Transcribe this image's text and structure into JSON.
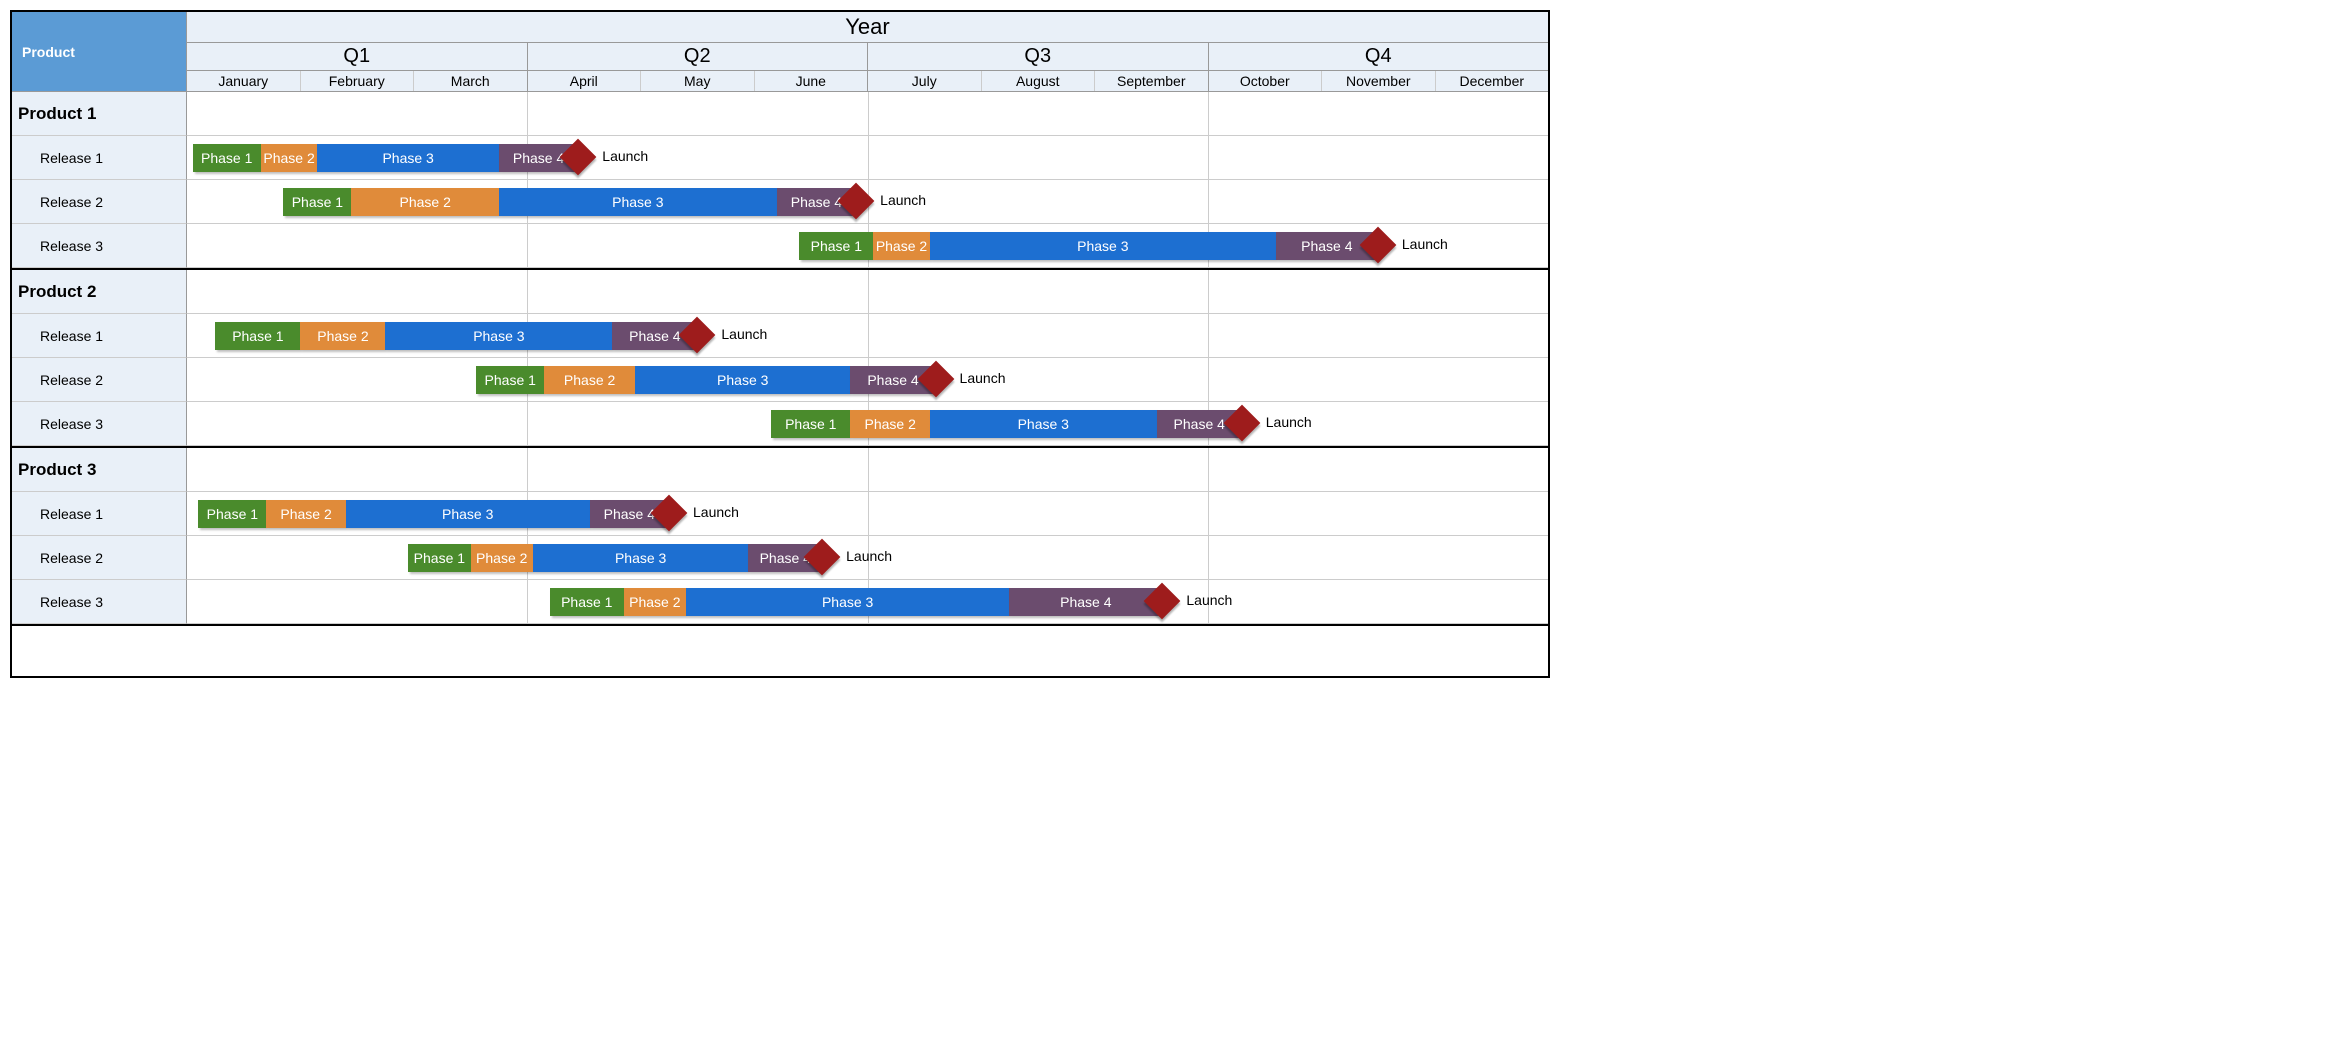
{
  "header": {
    "product_label": "Product",
    "year_label": "Year",
    "quarters": [
      "Q1",
      "Q2",
      "Q3",
      "Q4"
    ],
    "months": [
      "January",
      "February",
      "March",
      "April",
      "May",
      "June",
      "July",
      "August",
      "September",
      "October",
      "November",
      "December"
    ]
  },
  "phase_labels": {
    "phase1": "Phase 1",
    "phase2": "Phase 2",
    "phase3": "Phase 3",
    "phase4": "Phase 4",
    "launch": "Launch"
  },
  "colors": {
    "phase1": "#4a8b2c",
    "phase2": "#e08b3a",
    "phase3": "#1d6fd1",
    "phase4": "#6b4c6e",
    "milestone": "#9e1c1c",
    "header_blue": "#5b9bd5",
    "light_blue": "#e9f0f8"
  },
  "chart_data": {
    "type": "gantt",
    "title": "Year",
    "x_axis": {
      "quarters": [
        "Q1",
        "Q2",
        "Q3",
        "Q4"
      ],
      "months": [
        "January",
        "February",
        "March",
        "April",
        "May",
        "June",
        "July",
        "August",
        "September",
        "October",
        "November",
        "December"
      ],
      "range": [
        0,
        12
      ]
    },
    "products": [
      {
        "name": "Product 1",
        "releases": [
          {
            "name": "Release 1",
            "bars": [
              {
                "phase": "phase1",
                "start": 0.05,
                "end": 0.65
              },
              {
                "phase": "phase2",
                "start": 0.65,
                "end": 1.15
              },
              {
                "phase": "phase3",
                "start": 1.15,
                "end": 2.75
              },
              {
                "phase": "phase4",
                "start": 2.75,
                "end": 3.45
              }
            ],
            "milestone": 3.45
          },
          {
            "name": "Release 2",
            "bars": [
              {
                "phase": "phase1",
                "start": 0.85,
                "end": 1.45
              },
              {
                "phase": "phase2",
                "start": 1.45,
                "end": 2.75
              },
              {
                "phase": "phase3",
                "start": 2.75,
                "end": 5.2
              },
              {
                "phase": "phase4",
                "start": 5.2,
                "end": 5.9
              }
            ],
            "milestone": 5.9
          },
          {
            "name": "Release 3",
            "bars": [
              {
                "phase": "phase1",
                "start": 5.4,
                "end": 6.05
              },
              {
                "phase": "phase2",
                "start": 6.05,
                "end": 6.55
              },
              {
                "phase": "phase3",
                "start": 6.55,
                "end": 9.6
              },
              {
                "phase": "phase4",
                "start": 9.6,
                "end": 10.5
              }
            ],
            "milestone": 10.5
          }
        ]
      },
      {
        "name": "Product 2",
        "releases": [
          {
            "name": "Release 1",
            "bars": [
              {
                "phase": "phase1",
                "start": 0.25,
                "end": 1.0
              },
              {
                "phase": "phase2",
                "start": 1.0,
                "end": 1.75
              },
              {
                "phase": "phase3",
                "start": 1.75,
                "end": 3.75
              },
              {
                "phase": "phase4",
                "start": 3.75,
                "end": 4.5
              }
            ],
            "milestone": 4.5
          },
          {
            "name": "Release 2",
            "bars": [
              {
                "phase": "phase1",
                "start": 2.55,
                "end": 3.15
              },
              {
                "phase": "phase2",
                "start": 3.15,
                "end": 3.95
              },
              {
                "phase": "phase3",
                "start": 3.95,
                "end": 5.85
              },
              {
                "phase": "phase4",
                "start": 5.85,
                "end": 6.6
              }
            ],
            "milestone": 6.6
          },
          {
            "name": "Release 3",
            "bars": [
              {
                "phase": "phase1",
                "start": 5.15,
                "end": 5.85
              },
              {
                "phase": "phase2",
                "start": 5.85,
                "end": 6.55
              },
              {
                "phase": "phase3",
                "start": 6.55,
                "end": 8.55
              },
              {
                "phase": "phase4",
                "start": 8.55,
                "end": 9.3
              }
            ],
            "milestone": 9.3
          }
        ]
      },
      {
        "name": "Product 3",
        "releases": [
          {
            "name": "Release 1",
            "bars": [
              {
                "phase": "phase1",
                "start": 0.1,
                "end": 0.7
              },
              {
                "phase": "phase2",
                "start": 0.7,
                "end": 1.4
              },
              {
                "phase": "phase3",
                "start": 1.4,
                "end": 3.55
              },
              {
                "phase": "phase4",
                "start": 3.55,
                "end": 4.25
              }
            ],
            "milestone": 4.25
          },
          {
            "name": "Release 2",
            "bars": [
              {
                "phase": "phase1",
                "start": 1.95,
                "end": 2.5
              },
              {
                "phase": "phase2",
                "start": 2.5,
                "end": 3.05
              },
              {
                "phase": "phase3",
                "start": 3.05,
                "end": 4.95
              },
              {
                "phase": "phase4",
                "start": 4.95,
                "end": 5.6
              }
            ],
            "milestone": 5.6
          },
          {
            "name": "Release 3",
            "bars": [
              {
                "phase": "phase1",
                "start": 3.2,
                "end": 3.85
              },
              {
                "phase": "phase2",
                "start": 3.85,
                "end": 4.4
              },
              {
                "phase": "phase3",
                "start": 4.4,
                "end": 7.25
              },
              {
                "phase": "phase4",
                "start": 7.25,
                "end": 8.6
              }
            ],
            "milestone": 8.6
          }
        ]
      }
    ]
  }
}
